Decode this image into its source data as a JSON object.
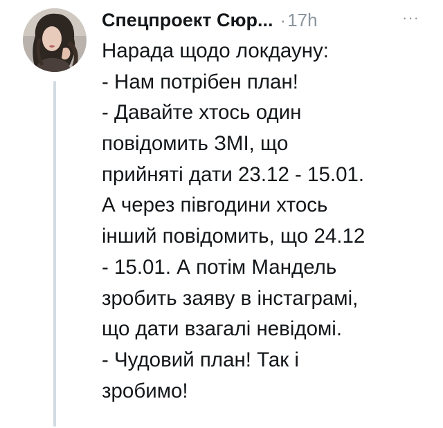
{
  "tweet": {
    "author_name": "Спецпроект Сюр...",
    "separator": "·",
    "timestamp": "17h",
    "more_label": "···",
    "lines": [
      "Нарада щодо локдауну:",
      "- Нам потрібен план!",
      "- Давайте хтось один",
      "повідомить ЗМІ, що",
      "прийняті дати 23.12 - 15.01.",
      "А через півгодини хтось",
      "інший повідомить, що 24.12",
      "- 15.01. А потім Мандель",
      "зробить заяву в інстаграмі,",
      "що дати взагалі невідомі.",
      "- Чудовий план! Так і",
      "зробимо!"
    ]
  },
  "colors": {
    "text": "#14171a",
    "secondary": "#8a959e",
    "thread_line": "#d3dbe2"
  },
  "icons": {
    "more": "more-horizontal-icon"
  }
}
